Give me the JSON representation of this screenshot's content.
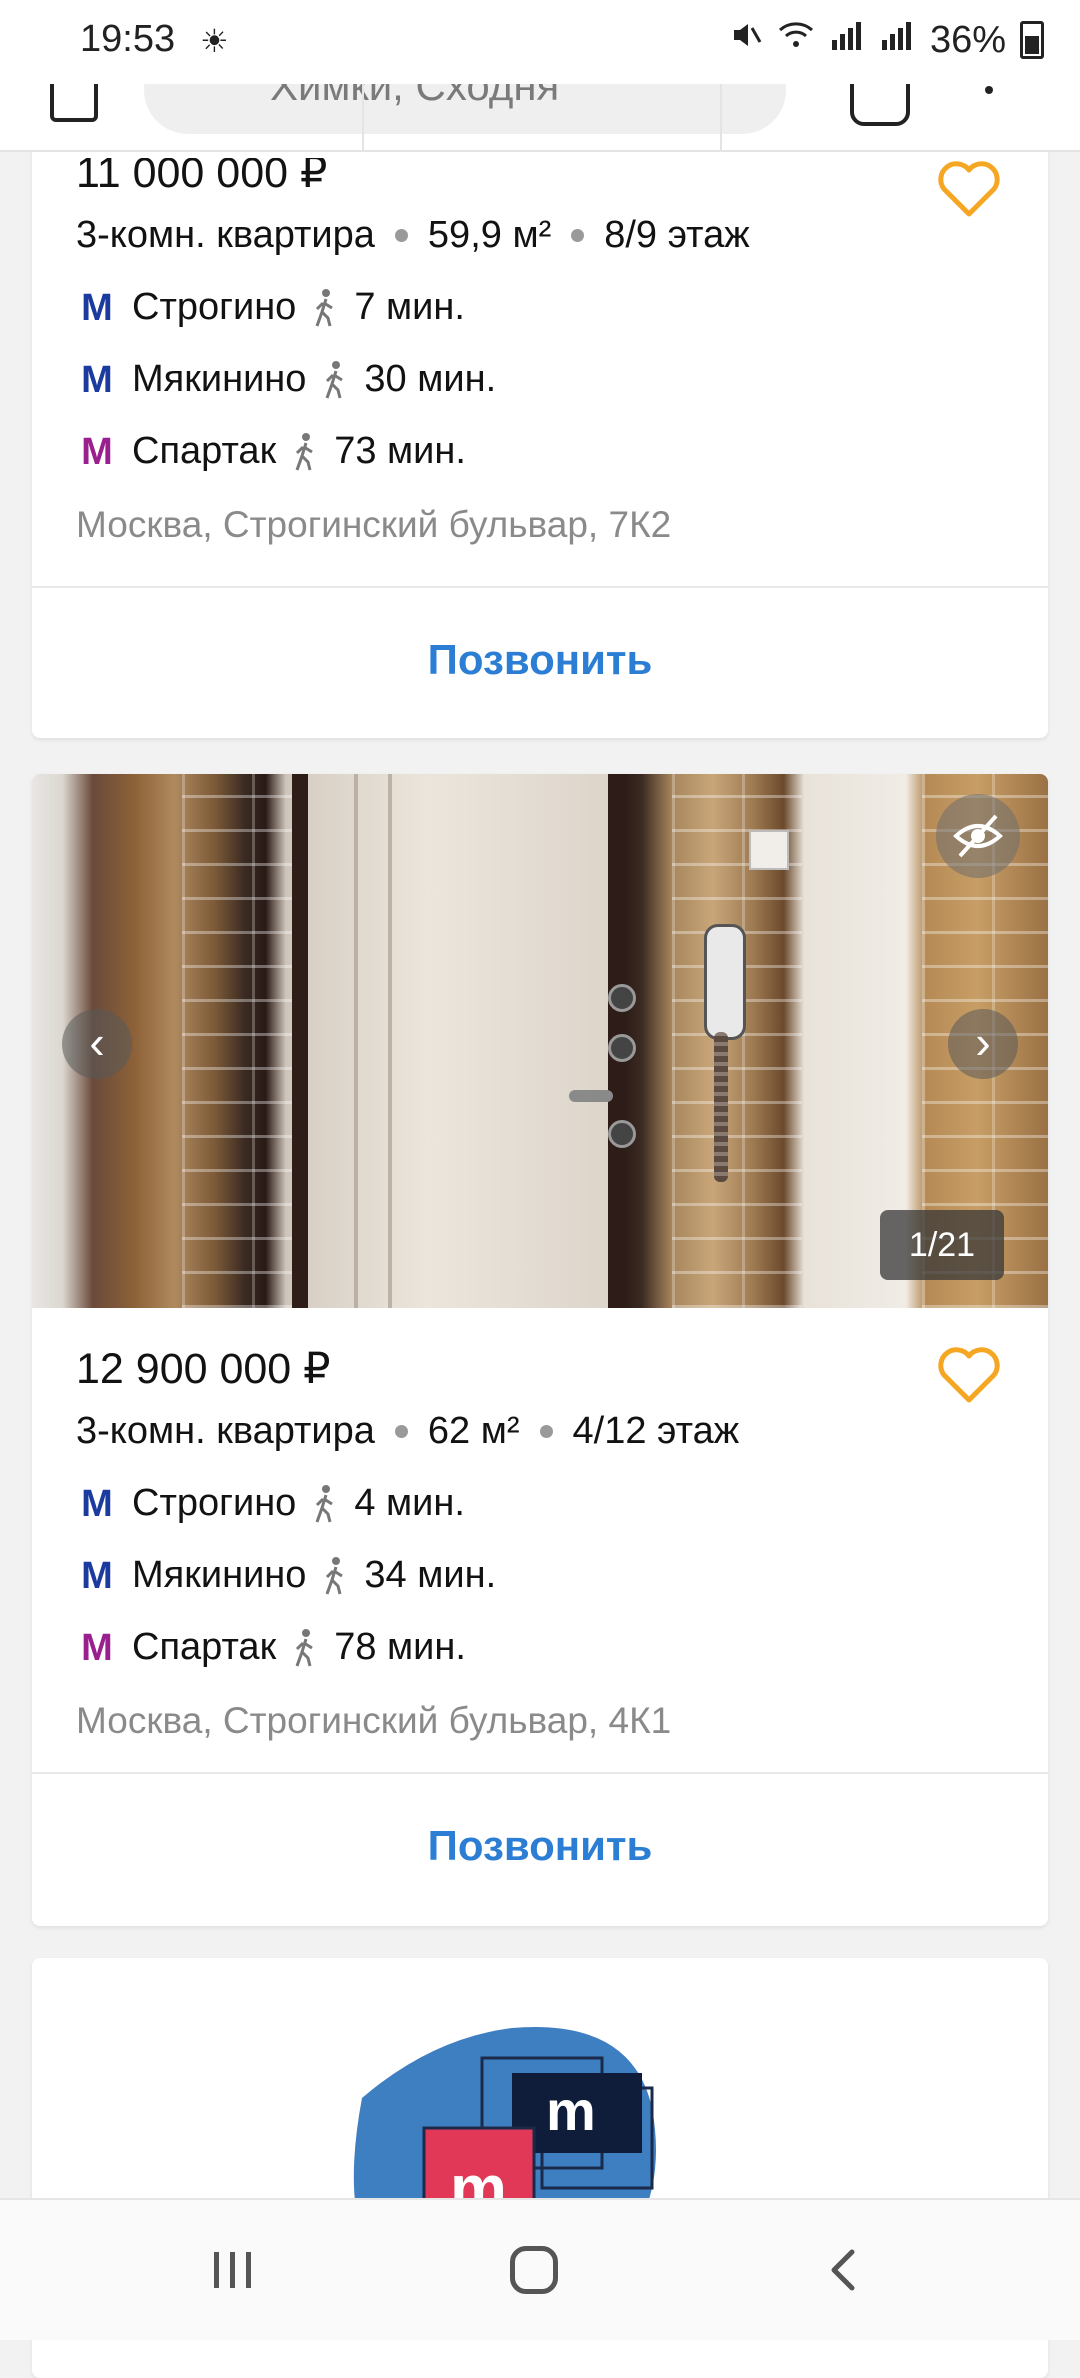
{
  "status_bar": {
    "time": "19:53",
    "battery": "36%"
  },
  "header": {
    "search_text": "Химки, Сходня"
  },
  "listings": [
    {
      "price": "11 000 000 ₽",
      "type": "3-комн. квартира",
      "area": "59,9 м²",
      "floor": "8/9 этаж",
      "metro": [
        {
          "station": "Строгино",
          "time": "7 мин.",
          "color": "#1b3c9e"
        },
        {
          "station": "Мякинино",
          "time": "30 мин.",
          "color": "#1b3c9e"
        },
        {
          "station": "Спартак",
          "time": "73 мин.",
          "color": "#9a1f8f"
        }
      ],
      "address": "Москва, Строгинский бульвар, 7К2",
      "call_label": "Позвонить"
    },
    {
      "photo_counter": "1/21",
      "price": "12 900 000 ₽",
      "type": "3-комн. квартира",
      "area": "62 м²",
      "floor": "4/12 этаж",
      "metro": [
        {
          "station": "Строгино",
          "time": "4 мин.",
          "color": "#1b3c9e"
        },
        {
          "station": "Мякинино",
          "time": "34 мин.",
          "color": "#1b3c9e"
        },
        {
          "station": "Спартак",
          "time": "78 мин.",
          "color": "#9a1f8f"
        }
      ],
      "address": "Москва, Строгинский бульвар, 4К1",
      "call_label": "Позвонить"
    }
  ],
  "colors": {
    "accent": "#2b7ed3",
    "favorite": "#f5a623",
    "metro_line_blue": "#1b3c9e",
    "metro_line_purple": "#9a1f8f"
  },
  "icons": [
    "wifi-icon",
    "mute-icon",
    "signal-icon",
    "battery-icon",
    "heart-icon",
    "hide-icon",
    "chevron-left-icon",
    "chevron-right-icon",
    "walk-icon",
    "metro-icon",
    "recents-icon",
    "home-icon",
    "back-icon"
  ]
}
